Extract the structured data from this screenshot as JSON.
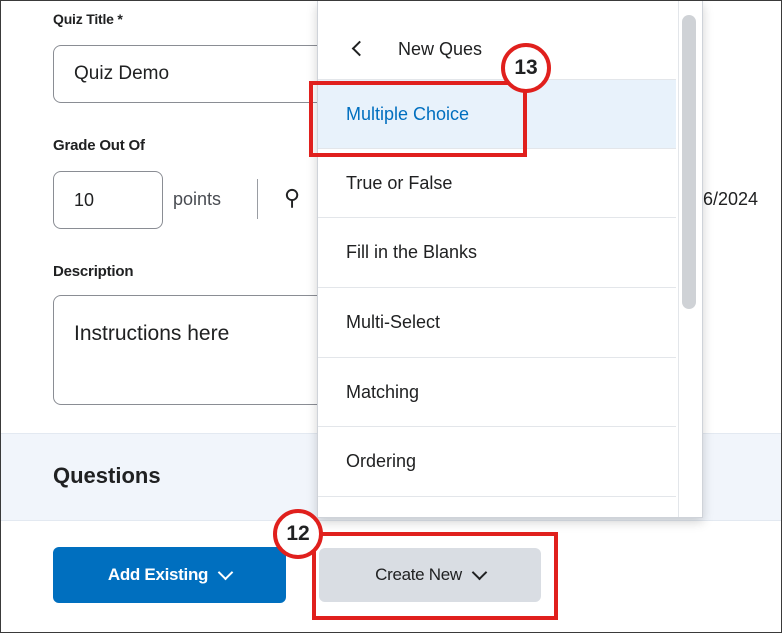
{
  "form": {
    "quiz_title_label": "Quiz Title *",
    "quiz_title_value": "Quiz Demo",
    "grade_label": "Grade Out Of",
    "grade_value": "10",
    "points_text": "points",
    "date_fragment": "6/2024",
    "description_label": "Description",
    "description_value": "Instructions here"
  },
  "questions": {
    "title": "Questions",
    "add_existing_label": "Add Existing",
    "create_new_label": "Create New"
  },
  "menu": {
    "header": "New Ques",
    "items": [
      {
        "label": "Multiple Choice"
      },
      {
        "label": "True or False"
      },
      {
        "label": "Fill in the Blanks"
      },
      {
        "label": "Multi-Select"
      },
      {
        "label": "Matching"
      },
      {
        "label": "Ordering"
      }
    ]
  },
  "annotations": {
    "step_12": "12",
    "step_13": "13"
  },
  "colors": {
    "accent": "#006fbf",
    "highlight": "#e0201d",
    "active_bg": "#e8f2fb"
  }
}
